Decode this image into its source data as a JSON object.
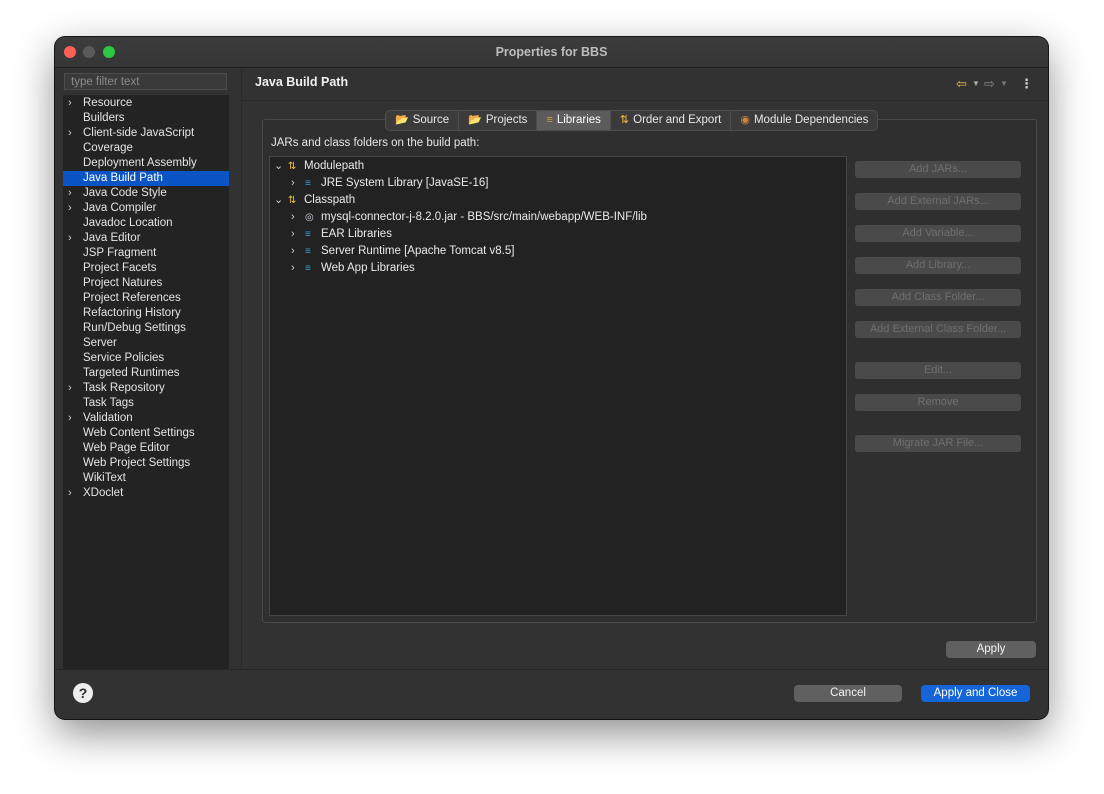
{
  "window": {
    "title": "Properties for BBS"
  },
  "filter": {
    "placeholder": "type filter text"
  },
  "sidebar": {
    "items": [
      {
        "label": "Resource",
        "expandable": true
      },
      {
        "label": "Builders",
        "expandable": false
      },
      {
        "label": "Client-side JavaScript",
        "expandable": true
      },
      {
        "label": "Coverage",
        "expandable": false
      },
      {
        "label": "Deployment Assembly",
        "expandable": false
      },
      {
        "label": "Java Build Path",
        "expandable": false,
        "selected": true
      },
      {
        "label": "Java Code Style",
        "expandable": true
      },
      {
        "label": "Java Compiler",
        "expandable": true
      },
      {
        "label": "Javadoc Location",
        "expandable": false
      },
      {
        "label": "Java Editor",
        "expandable": true
      },
      {
        "label": "JSP Fragment",
        "expandable": false
      },
      {
        "label": "Project Facets",
        "expandable": false
      },
      {
        "label": "Project Natures",
        "expandable": false
      },
      {
        "label": "Project References",
        "expandable": false
      },
      {
        "label": "Refactoring History",
        "expandable": false
      },
      {
        "label": "Run/Debug Settings",
        "expandable": false
      },
      {
        "label": "Server",
        "expandable": false
      },
      {
        "label": "Service Policies",
        "expandable": false
      },
      {
        "label": "Targeted Runtimes",
        "expandable": false
      },
      {
        "label": "Task Repository",
        "expandable": true
      },
      {
        "label": "Task Tags",
        "expandable": false
      },
      {
        "label": "Validation",
        "expandable": true
      },
      {
        "label": "Web Content Settings",
        "expandable": false
      },
      {
        "label": "Web Page Editor",
        "expandable": false
      },
      {
        "label": "Web Project Settings",
        "expandable": false
      },
      {
        "label": "WikiText",
        "expandable": false
      },
      {
        "label": "XDoclet",
        "expandable": true
      }
    ]
  },
  "panel": {
    "title": "Java Build Path",
    "caption": "JARs and class folders on the build path:"
  },
  "tabs": [
    {
      "label": "Source",
      "icon": "source-folder-icon",
      "active": false
    },
    {
      "label": "Projects",
      "icon": "projects-icon",
      "active": false
    },
    {
      "label": "Libraries",
      "icon": "libraries-icon",
      "active": true
    },
    {
      "label": "Order and Export",
      "icon": "order-export-icon",
      "active": false
    },
    {
      "label": "Module Dependencies",
      "icon": "module-icon",
      "active": false
    }
  ],
  "tree": [
    {
      "label": "Modulepath",
      "depth": 0,
      "expanded": true,
      "icon": "path-icon"
    },
    {
      "label": "JRE System Library [JavaSE-16]",
      "depth": 1,
      "expanded": false,
      "icon": "library-icon"
    },
    {
      "label": "Classpath",
      "depth": 0,
      "expanded": true,
      "icon": "path-icon"
    },
    {
      "label": "mysql-connector-j-8.2.0.jar - BBS/src/main/webapp/WEB-INF/lib",
      "depth": 1,
      "expanded": false,
      "icon": "jar-icon"
    },
    {
      "label": "EAR Libraries",
      "depth": 1,
      "expanded": false,
      "icon": "library-icon"
    },
    {
      "label": "Server Runtime [Apache Tomcat v8.5]",
      "depth": 1,
      "expanded": false,
      "icon": "library-icon"
    },
    {
      "label": "Web App Libraries",
      "depth": 1,
      "expanded": false,
      "icon": "library-icon"
    }
  ],
  "side_buttons": [
    {
      "label": "Add JARs..."
    },
    {
      "label": "Add External JARs..."
    },
    {
      "label": "Add Variable..."
    },
    {
      "label": "Add Library..."
    },
    {
      "label": "Add Class Folder..."
    },
    {
      "label": "Add External Class Folder..."
    },
    {
      "label": "Edit..."
    },
    {
      "label": "Remove"
    },
    {
      "label": "Migrate JAR File..."
    }
  ],
  "buttons": {
    "apply": "Apply",
    "cancel": "Cancel",
    "apply_close": "Apply and Close"
  },
  "help": {
    "glyph": "?"
  }
}
